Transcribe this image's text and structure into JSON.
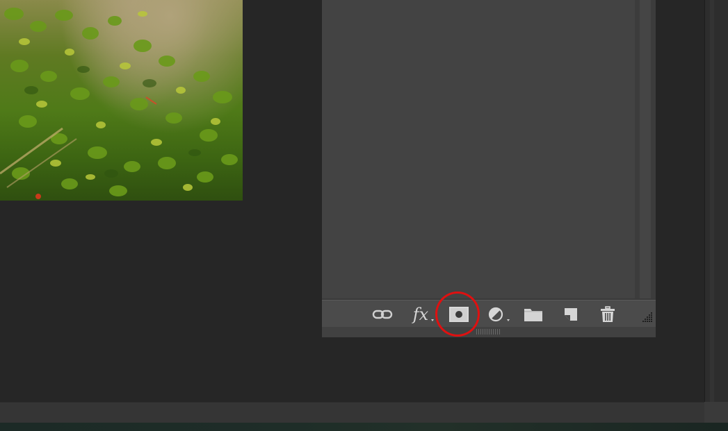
{
  "colors": {
    "workspace_bg": "#262626",
    "panel_bg": "#434343",
    "footer_bg": "#4b4b4b",
    "icon_color": "#d6d6d6",
    "highlight_ring": "#e01010"
  },
  "layers_panel": {
    "footer_tools": [
      {
        "name": "link-layers",
        "icon": "link-icon"
      },
      {
        "name": "add-layer-style",
        "label": "fx",
        "icon": "fx-icon"
      },
      {
        "name": "add-layer-mask",
        "icon": "layer-mask-icon"
      },
      {
        "name": "new-fill-adjustment-layer",
        "icon": "adjustment-circle-icon"
      },
      {
        "name": "new-group",
        "icon": "folder-icon"
      },
      {
        "name": "new-layer",
        "icon": "new-layer-icon"
      },
      {
        "name": "delete-layer",
        "icon": "trash-icon"
      }
    ]
  },
  "annotation": {
    "highlighted_tool": "add-layer-mask"
  }
}
